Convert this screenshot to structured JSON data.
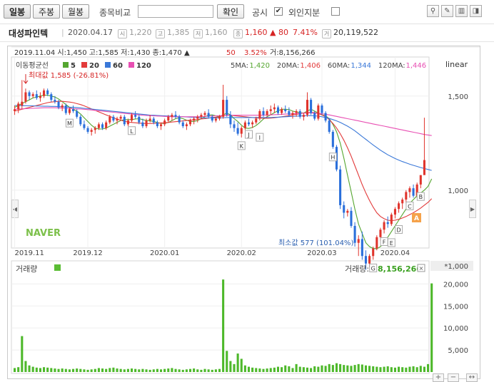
{
  "toolbar": {
    "period_buttons": [
      "일봉",
      "주봉",
      "월봉"
    ],
    "compare_label": "종목비교",
    "confirm_label": "확인",
    "disclosure_label": "공시",
    "disclosure_checked": "✔",
    "foreign_label": "외인지분"
  },
  "stock": {
    "name": "대성파인텍",
    "date": "2020.04.17",
    "open_icon": "시",
    "open": "1,220",
    "high_icon": "고",
    "high": "1,385",
    "low_icon": "저",
    "low": "1,160",
    "close_icon": "종",
    "close": "1,160",
    "change": "▲ 80",
    "change_pct": "7.41%",
    "volume_icon": "거",
    "volume": "20,119,522"
  },
  "price_panel": {
    "hover_info": "2019.11.04 시:1,450  고:1,585  저:1,430  종:1,470 ▲",
    "hover_change": "50",
    "hover_pct": "3.52%",
    "hover_volume": "거:8,156,266",
    "ma_title": "이동평균선",
    "ma_legend": [
      {
        "period": "5",
        "color": "#55a630"
      },
      {
        "period": "20",
        "color": "#e23a3a"
      },
      {
        "period": "60",
        "color": "#3a78d8"
      },
      {
        "period": "120",
        "color": "#e84fb3"
      }
    ],
    "ma_values": [
      {
        "label": "5MA:",
        "value": "1,420",
        "color": "#55a630"
      },
      {
        "label": "20MA:",
        "value": "1,406",
        "color": "#e23a3a"
      },
      {
        "label": "60MA:",
        "value": "1,344",
        "color": "#3a78d8"
      },
      {
        "label": "120MA:",
        "value": "1,446",
        "color": "#e84fb3"
      }
    ],
    "scale_label": "linear",
    "max_label": "최대값 1,585 (-26.81%)",
    "min_label": "최소값 577 (101.04%)",
    "watermark": "NAVER",
    "a_marker": "A",
    "event_letters": [
      "M",
      "L",
      "K",
      "J",
      "I",
      "H",
      "G",
      "F",
      "E",
      "D",
      "C",
      "B"
    ]
  },
  "volume_panel": {
    "title": "거래량",
    "value_label": "거래량:",
    "value": "8,156,266",
    "unit": "*1,000",
    "close_icon": "✕"
  },
  "chart_data": {
    "type": "candlestick",
    "price_ylim": [
      700,
      1700
    ],
    "price_ticks": [
      1000,
      1500
    ],
    "price_tick_labels": [
      "1,000",
      "1,500"
    ],
    "date_labels": [
      "2019.11",
      "2019.12",
      "2020.01",
      "2020.02",
      "2020.03",
      "2020.04"
    ],
    "candles": [
      [
        1420,
        1450,
        1400,
        1430
      ],
      [
        1430,
        1470,
        1410,
        1460
      ],
      [
        1450,
        1585,
        1430,
        1470
      ],
      [
        1470,
        1540,
        1460,
        1520
      ],
      [
        1520,
        1530,
        1480,
        1500
      ],
      [
        1500,
        1520,
        1490,
        1510
      ],
      [
        1510,
        1530,
        1480,
        1490
      ],
      [
        1490,
        1520,
        1470,
        1500
      ],
      [
        1500,
        1540,
        1490,
        1530
      ],
      [
        1530,
        1540,
        1500,
        1510
      ],
      [
        1510,
        1520,
        1470,
        1480
      ],
      [
        1480,
        1500,
        1460,
        1470
      ],
      [
        1470,
        1480,
        1430,
        1440
      ],
      [
        1440,
        1460,
        1420,
        1450
      ],
      [
        1450,
        1460,
        1400,
        1410
      ],
      [
        1410,
        1440,
        1400,
        1430
      ],
      [
        1430,
        1450,
        1410,
        1420
      ],
      [
        1420,
        1430,
        1380,
        1390
      ],
      [
        1390,
        1400,
        1340,
        1350
      ],
      [
        1350,
        1370,
        1320,
        1330
      ],
      [
        1330,
        1340,
        1300,
        1310
      ],
      [
        1310,
        1330,
        1290,
        1320
      ],
      [
        1320,
        1340,
        1300,
        1330
      ],
      [
        1330,
        1360,
        1320,
        1350
      ],
      [
        1350,
        1360,
        1320,
        1330
      ],
      [
        1330,
        1370,
        1320,
        1360
      ],
      [
        1360,
        1400,
        1350,
        1390
      ],
      [
        1390,
        1400,
        1360,
        1370
      ],
      [
        1370,
        1390,
        1350,
        1380
      ],
      [
        1380,
        1400,
        1370,
        1390
      ],
      [
        1390,
        1400,
        1340,
        1350
      ],
      [
        1350,
        1380,
        1340,
        1370
      ],
      [
        1370,
        1410,
        1360,
        1400
      ],
      [
        1400,
        1420,
        1380,
        1390
      ],
      [
        1390,
        1400,
        1350,
        1360
      ],
      [
        1360,
        1380,
        1330,
        1340
      ],
      [
        1340,
        1380,
        1330,
        1370
      ],
      [
        1370,
        1400,
        1360,
        1380
      ],
      [
        1380,
        1390,
        1350,
        1360
      ],
      [
        1360,
        1370,
        1330,
        1340
      ],
      [
        1340,
        1360,
        1320,
        1350
      ],
      [
        1350,
        1380,
        1340,
        1370
      ],
      [
        1370,
        1400,
        1360,
        1390
      ],
      [
        1390,
        1410,
        1370,
        1400
      ],
      [
        1400,
        1420,
        1380,
        1390
      ],
      [
        1390,
        1400,
        1350,
        1360
      ],
      [
        1360,
        1370,
        1330,
        1340
      ],
      [
        1340,
        1360,
        1320,
        1350
      ],
      [
        1350,
        1380,
        1340,
        1370
      ],
      [
        1370,
        1390,
        1350,
        1380
      ],
      [
        1380,
        1400,
        1360,
        1390
      ],
      [
        1390,
        1410,
        1380,
        1400
      ],
      [
        1400,
        1420,
        1390,
        1410
      ],
      [
        1410,
        1430,
        1380,
        1390
      ],
      [
        1390,
        1400,
        1360,
        1370
      ],
      [
        1370,
        1390,
        1360,
        1380
      ],
      [
        1380,
        1400,
        1370,
        1390
      ],
      [
        1390,
        1560,
        1380,
        1480
      ],
      [
        1480,
        1500,
        1390,
        1400
      ],
      [
        1400,
        1420,
        1330,
        1350
      ],
      [
        1350,
        1370,
        1310,
        1330
      ],
      [
        1330,
        1360,
        1290,
        1300
      ],
      [
        1300,
        1340,
        1280,
        1330
      ],
      [
        1330,
        1370,
        1320,
        1360
      ],
      [
        1360,
        1380,
        1340,
        1350
      ],
      [
        1350,
        1370,
        1330,
        1360
      ],
      [
        1360,
        1390,
        1350,
        1380
      ],
      [
        1380,
        1430,
        1370,
        1420
      ],
      [
        1420,
        1440,
        1390,
        1400
      ],
      [
        1400,
        1430,
        1390,
        1420
      ],
      [
        1420,
        1450,
        1400,
        1430
      ],
      [
        1430,
        1460,
        1410,
        1440
      ],
      [
        1440,
        1450,
        1400,
        1410
      ],
      [
        1410,
        1440,
        1400,
        1430
      ],
      [
        1430,
        1450,
        1410,
        1420
      ],
      [
        1420,
        1440,
        1390,
        1400
      ],
      [
        1400,
        1420,
        1380,
        1410
      ],
      [
        1410,
        1430,
        1390,
        1420
      ],
      [
        1420,
        1430,
        1380,
        1390
      ],
      [
        1390,
        1410,
        1370,
        1400
      ],
      [
        1400,
        1520,
        1390,
        1480
      ],
      [
        1480,
        1490,
        1400,
        1410
      ],
      [
        1410,
        1420,
        1370,
        1380
      ],
      [
        1380,
        1460,
        1370,
        1450
      ],
      [
        1450,
        1460,
        1400,
        1410
      ],
      [
        1410,
        1420,
        1360,
        1370
      ],
      [
        1370,
        1380,
        1300,
        1310
      ],
      [
        1310,
        1320,
        1220,
        1230
      ],
      [
        1230,
        1240,
        1100,
        1110
      ],
      [
        1110,
        1130,
        900,
        920
      ],
      [
        920,
        940,
        850,
        880
      ],
      [
        880,
        900,
        860,
        890
      ],
      [
        890,
        910,
        800,
        810
      ],
      [
        810,
        830,
        700,
        720
      ],
      [
        720,
        760,
        650,
        740
      ],
      [
        740,
        780,
        630,
        650
      ],
      [
        650,
        680,
        577,
        610
      ],
      [
        610,
        660,
        590,
        650
      ],
      [
        650,
        700,
        630,
        690
      ],
      [
        690,
        760,
        680,
        750
      ],
      [
        750,
        800,
        730,
        790
      ],
      [
        790,
        840,
        770,
        830
      ],
      [
        830,
        860,
        800,
        820
      ],
      [
        820,
        880,
        810,
        870
      ],
      [
        870,
        910,
        850,
        900
      ],
      [
        900,
        940,
        880,
        930
      ],
      [
        930,
        960,
        900,
        950
      ],
      [
        950,
        1000,
        930,
        990
      ],
      [
        990,
        1020,
        960,
        1010
      ],
      [
        1010,
        1030,
        960,
        970
      ],
      [
        970,
        1040,
        960,
        1030
      ],
      [
        1030,
        1080,
        1010,
        1080
      ],
      [
        1080,
        1385,
        1160,
        1160
      ]
    ],
    "ma5": [
      1440,
      1450,
      1460,
      1470,
      1480,
      1490,
      1495,
      1500,
      1505,
      1505,
      1500,
      1495,
      1485,
      1470,
      1455,
      1440,
      1430,
      1420,
      1405,
      1385,
      1365,
      1345,
      1330,
      1325,
      1325,
      1330,
      1340,
      1350,
      1360,
      1370,
      1375,
      1375,
      1375,
      1378,
      1380,
      1375,
      1370,
      1368,
      1365,
      1360,
      1355,
      1355,
      1360,
      1370,
      1380,
      1385,
      1380,
      1372,
      1365,
      1365,
      1370,
      1380,
      1390,
      1398,
      1400,
      1395,
      1390,
      1400,
      1410,
      1400,
      1380,
      1365,
      1345,
      1330,
      1328,
      1333,
      1343,
      1360,
      1378,
      1390,
      1400,
      1412,
      1422,
      1430,
      1430,
      1428,
      1420,
      1415,
      1412,
      1410,
      1420,
      1430,
      1420,
      1410,
      1400,
      1395,
      1380,
      1350,
      1310,
      1250,
      1170,
      1080,
      990,
      900,
      820,
      770,
      720,
      700,
      690,
      688,
      700,
      720,
      750,
      780,
      810,
      840,
      870,
      900,
      930,
      950,
      970,
      985,
      1000,
      1020,
      1060
    ],
    "ma20": [
      1420,
      1425,
      1430,
      1435,
      1440,
      1445,
      1450,
      1455,
      1460,
      1465,
      1468,
      1470,
      1472,
      1472,
      1470,
      1468,
      1465,
      1460,
      1455,
      1448,
      1440,
      1432,
      1424,
      1416,
      1408,
      1400,
      1392,
      1384,
      1378,
      1372,
      1366,
      1362,
      1360,
      1358,
      1356,
      1355,
      1354,
      1354,
      1355,
      1356,
      1357,
      1358,
      1360,
      1362,
      1364,
      1366,
      1368,
      1370,
      1372,
      1374,
      1376,
      1378,
      1380,
      1383,
      1386,
      1388,
      1390,
      1395,
      1398,
      1398,
      1396,
      1394,
      1392,
      1390,
      1388,
      1386,
      1384,
      1383,
      1382,
      1382,
      1383,
      1385,
      1387,
      1390,
      1393,
      1396,
      1400,
      1403,
      1406,
      1410,
      1412,
      1413,
      1412,
      1408,
      1400,
      1390,
      1375,
      1355,
      1330,
      1300,
      1265,
      1225,
      1180,
      1130,
      1080,
      1030,
      985,
      945,
      910,
      880,
      860,
      848,
      840,
      838,
      840,
      845,
      852,
      860,
      870,
      880,
      892,
      905,
      920,
      935,
      955
    ],
    "ma60": [
      1450,
      1450,
      1449,
      1449,
      1448,
      1448,
      1447,
      1447,
      1446,
      1446,
      1445,
      1445,
      1444,
      1443,
      1442,
      1441,
      1440,
      1439,
      1437,
      1435,
      1433,
      1431,
      1429,
      1427,
      1425,
      1423,
      1421,
      1419,
      1417,
      1415,
      1413,
      1411,
      1409,
      1407,
      1405,
      1403,
      1401,
      1399,
      1398,
      1397,
      1396,
      1395,
      1394,
      1393,
      1392,
      1391,
      1390,
      1389,
      1388,
      1387,
      1386,
      1385,
      1384,
      1384,
      1384,
      1384,
      1384,
      1385,
      1386,
      1386,
      1386,
      1386,
      1386,
      1386,
      1386,
      1386,
      1386,
      1386,
      1386,
      1386,
      1386,
      1387,
      1388,
      1389,
      1390,
      1391,
      1392,
      1393,
      1394,
      1395,
      1396,
      1396,
      1395,
      1393,
      1390,
      1386,
      1381,
      1375,
      1368,
      1360,
      1350,
      1340,
      1328,
      1315,
      1300,
      1285,
      1270,
      1255,
      1240,
      1226,
      1212,
      1200,
      1188,
      1178,
      1168,
      1160,
      1152,
      1145,
      1138,
      1132,
      1126,
      1120,
      1115,
      1110,
      1105
    ],
    "ma120": [
      1430,
      1431,
      1432,
      1433,
      1434,
      1435,
      1436,
      1437,
      1438,
      1438,
      1438,
      1438,
      1437,
      1436,
      1435,
      1434,
      1433,
      1432,
      1431,
      1430,
      1428,
      1426,
      1424,
      1422,
      1420,
      1418,
      1416,
      1414,
      1412,
      1410,
      1408,
      1406,
      1404,
      1402,
      1400,
      1398,
      1397,
      1396,
      1395,
      1394,
      1393,
      1392,
      1391,
      1390,
      1390,
      1390,
      1390,
      1390,
      1390,
      1390,
      1390,
      1391,
      1392,
      1393,
      1394,
      1395,
      1396,
      1397,
      1398,
      1398,
      1398,
      1398,
      1398,
      1398,
      1398,
      1398,
      1398,
      1398,
      1398,
      1399,
      1400,
      1401,
      1402,
      1403,
      1404,
      1405,
      1406,
      1407,
      1408,
      1409,
      1410,
      1410,
      1409,
      1408,
      1406,
      1403,
      1400,
      1396,
      1392,
      1388,
      1384,
      1380,
      1376,
      1372,
      1368,
      1364,
      1360,
      1356,
      1352,
      1348,
      1344,
      1340,
      1336,
      1332,
      1328,
      1324,
      1320,
      1316,
      1312,
      1308,
      1304,
      1300,
      1296,
      1293,
      1290
    ],
    "volume_ylim": [
      0,
      22000
    ],
    "volume_ticks": [
      5000,
      10000,
      15000,
      20000
    ],
    "volume_tick_labels": [
      "5,000",
      "10,000",
      "15,000",
      "20,000"
    ],
    "volume": [
      900,
      1100,
      8156,
      2500,
      1500,
      1200,
      1000,
      900,
      1100,
      1000,
      900,
      800,
      700,
      800,
      700,
      600,
      700,
      800,
      700,
      600,
      500,
      600,
      700,
      900,
      800,
      700,
      900,
      1000,
      800,
      700,
      600,
      700,
      800,
      700,
      600,
      700,
      600,
      500,
      600,
      700,
      600,
      700,
      800,
      900,
      700,
      600,
      500,
      600,
      700,
      800,
      600,
      500,
      700,
      600,
      500,
      600,
      700,
      21000,
      4800,
      2500,
      1800,
      4200,
      3000,
      1500,
      1200,
      1000,
      900,
      800,
      700,
      800,
      900,
      1000,
      1200,
      1100,
      1500,
      1300,
      900,
      1800,
      1200,
      1100,
      1000,
      900,
      1300,
      1200,
      1500,
      1400,
      1800,
      1600,
      2000,
      1800,
      1600,
      1500,
      1400,
      1600,
      1800,
      1700,
      1500,
      1400,
      1300,
      1200,
      1100,
      1200,
      1300,
      1100,
      1000,
      1200,
      1100,
      1000,
      1200,
      1300,
      1100,
      1400,
      1200,
      1800,
      20119
    ]
  }
}
